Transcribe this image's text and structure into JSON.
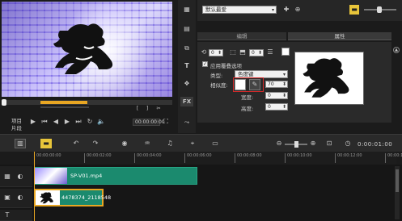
{
  "title_select": "默认最爱",
  "tabs": {
    "edit": "编辑",
    "properties": "属性"
  },
  "options": {
    "apply_overlay": "应用覆叠选项",
    "type_label": "类型:",
    "type_value": "色度键",
    "similarity_label": "相似度:",
    "similarity_value": "70",
    "width_label": "宽度:",
    "width_value": "0",
    "height_label": "高度:",
    "height_value": "0",
    "spin_left": "0",
    "spin_right": "0"
  },
  "player": {
    "project_label": "项目",
    "clip_label": "片段",
    "timecode": "00:00:00:00"
  },
  "timeline": {
    "time_display": "0:00:01:00",
    "ruler_ticks": [
      "00:00:00:00",
      "00:00:02:00",
      "00:00:04:00",
      "00:00:06:00",
      "00:00:08:00",
      "00:00:10:00",
      "00:00:12:00",
      "00:00:14:00"
    ],
    "clip1": "SP-V01.mp4",
    "clip2": "4478374_2118548"
  },
  "colors": {
    "clip": "#1b8a6e",
    "selection": "#e8a623",
    "panel": "#2a2a2a",
    "highlight_red": "#d62a2a"
  },
  "icons": [
    "clip-icon",
    "media-icon",
    "text-icon",
    "transition-icon",
    "fx-icon",
    "path-icon",
    "play-icon",
    "undo-icon",
    "redo-icon"
  ]
}
